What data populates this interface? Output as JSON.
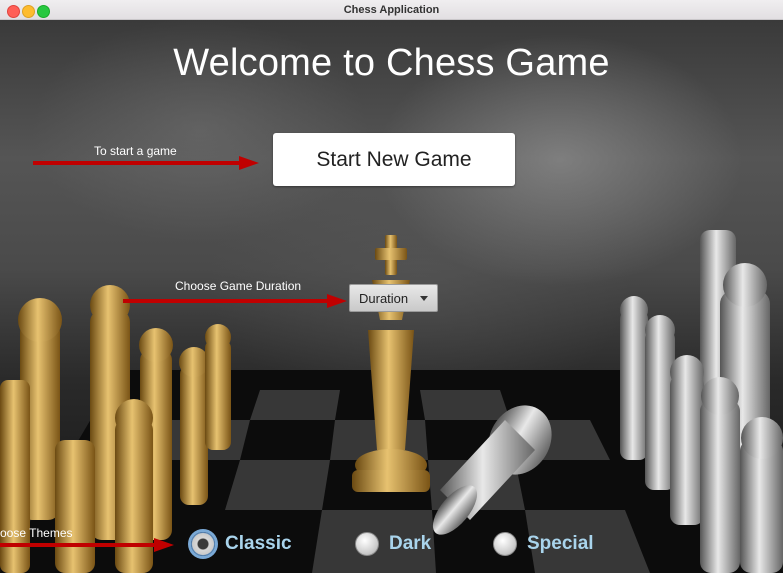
{
  "window": {
    "title": "Chess Application"
  },
  "main": {
    "heading": "Welcome to Chess Game",
    "start_button": "Start New Game",
    "duration_select": "Duration"
  },
  "annotations": {
    "start": "To start a game",
    "duration": "Choose Game Duration",
    "themes": "oose Themes"
  },
  "themes": {
    "options": [
      {
        "label": "Classic",
        "selected": true
      },
      {
        "label": "Dark",
        "selected": false
      },
      {
        "label": "Special",
        "selected": false
      }
    ]
  },
  "colors": {
    "arrow": "#c00000",
    "theme_text": "#a9d4ec",
    "heading": "#ffffff"
  }
}
